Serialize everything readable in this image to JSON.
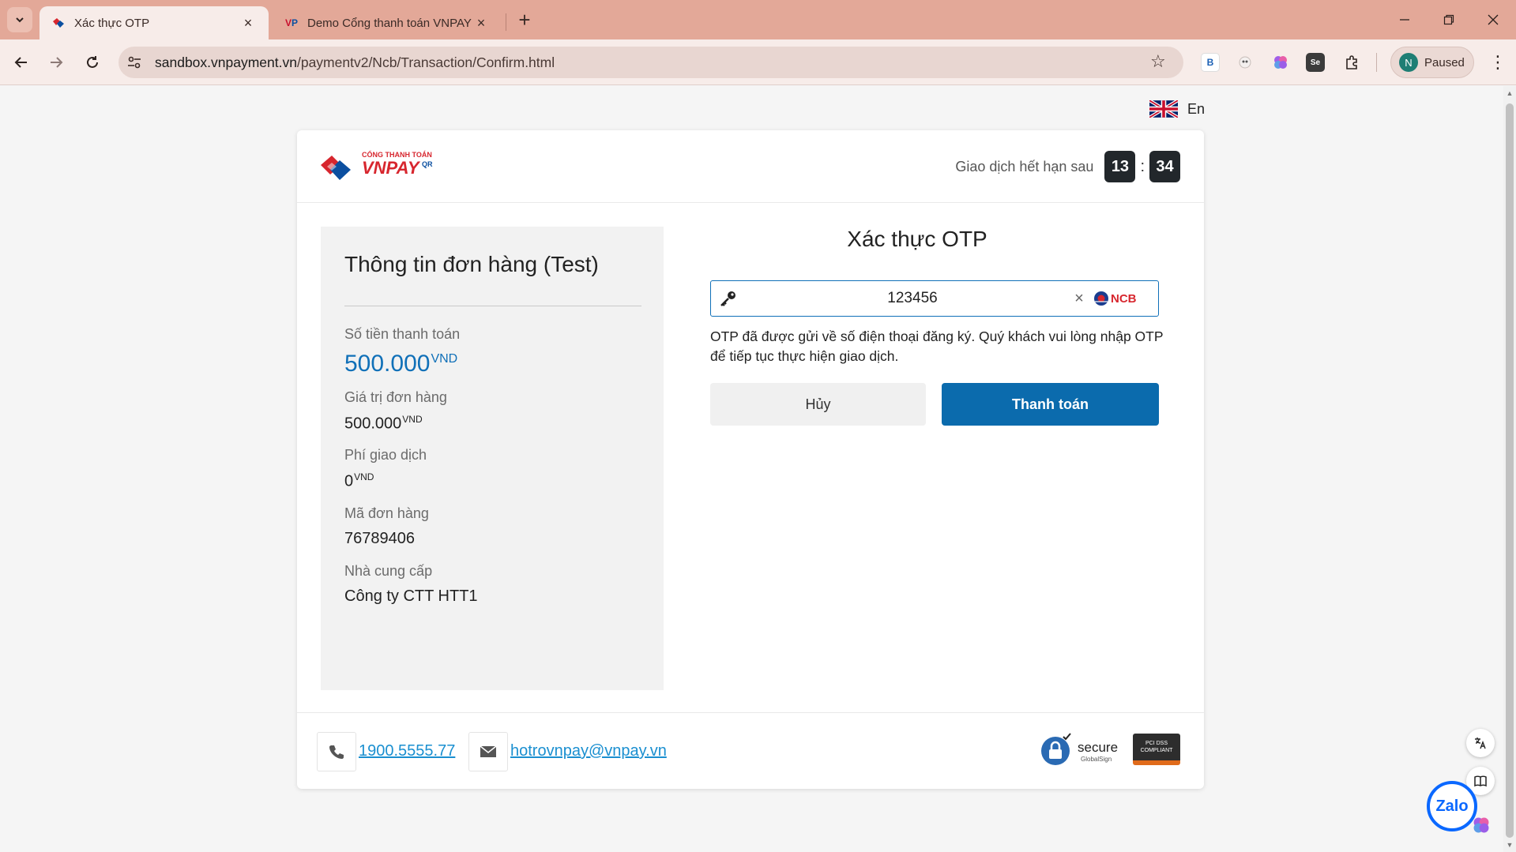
{
  "browser": {
    "tabs": [
      {
        "title": "Xác thực OTP",
        "active": true
      },
      {
        "title": "Demo Cổng thanh toán VNPAY",
        "active": false
      }
    ],
    "url_host": "sandbox.vnpayment.vn",
    "url_path": "/paymentv2/Ncb/Transaction/Confirm.html",
    "extensions": [
      "B"
    ],
    "profile": {
      "initial": "N",
      "status": "Paused"
    }
  },
  "page": {
    "language": "En",
    "logo": {
      "top_text": "CỔNG THANH TOÁN",
      "brand": "VNPAY",
      "suffix": "QR"
    },
    "expire": {
      "label": "Giao dịch hết hạn sau",
      "minutes": "13",
      "seconds": "34"
    },
    "order": {
      "title": "Thông tin đơn hàng (Test)",
      "amount_label": "Số tiền thanh toán",
      "amount_value": "500.000",
      "currency": "VND",
      "value_label": "Giá trị đơn hàng",
      "value_value": "500.000",
      "fee_label": "Phí giao dịch",
      "fee_value": "0",
      "order_id_label": "Mã đơn hàng",
      "order_id_value": "76789406",
      "provider_label": "Nhà cung cấp",
      "provider_value": "Công ty CTT HTT1"
    },
    "otp": {
      "title": "Xác thực OTP",
      "value": "123456",
      "bank": "NCB",
      "note": "OTP đã được gửi về số điện thoại đăng ký. Quý khách vui lòng nhập OTP để tiếp tục thực hiện giao dịch.",
      "cancel_label": "Hủy",
      "pay_label": "Thanh toán"
    },
    "footer": {
      "phone": "1900.5555.77",
      "email": "hotrovnpay@vnpay.vn",
      "secure_label": "secure",
      "secure_sub": "GlobalSign",
      "pci_label": "PCI DSS COMPLIANT"
    },
    "zalo_label": "Zalo"
  },
  "colors": {
    "accent": "#0b6bad",
    "link": "#1a8fd0",
    "tabbar": "#e3a898",
    "logo_red": "#d7262e",
    "logo_blue": "#0b4fa0"
  }
}
